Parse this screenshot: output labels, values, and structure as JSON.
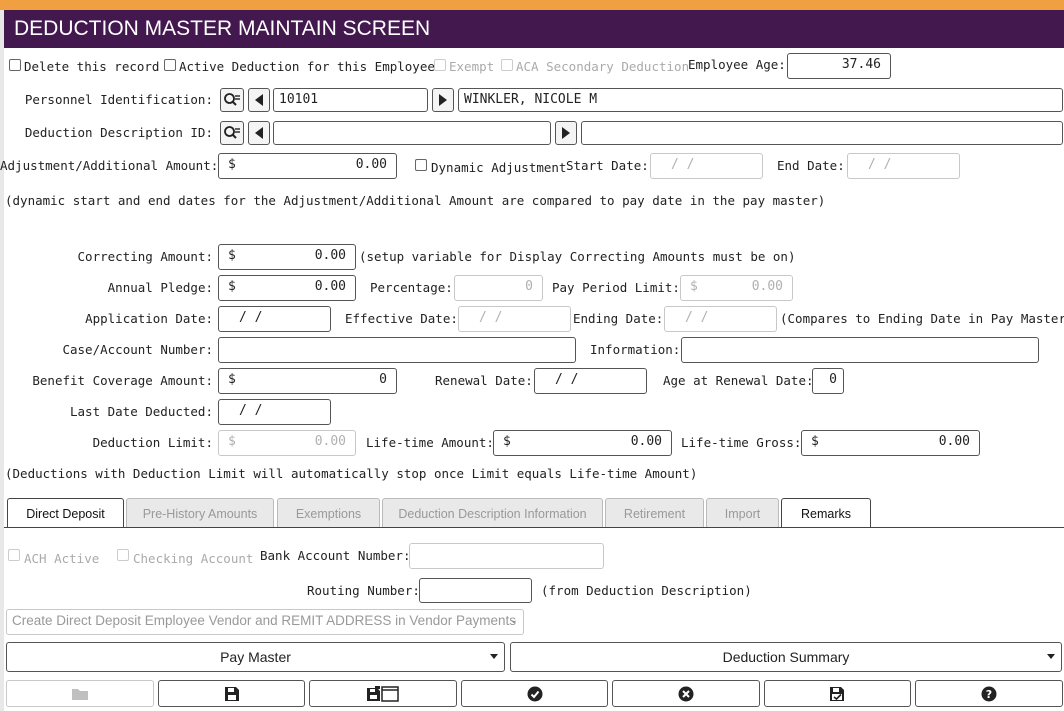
{
  "title": "DEDUCTION MASTER MAINTAIN SCREEN",
  "flags": {
    "delete_label": "Delete this record",
    "active_label": "Active Deduction for this Employee",
    "exempt_label": "Exempt",
    "aca_label": "ACA Secondary Deduction",
    "age_label": "Employee Age:",
    "age_value": "37.46"
  },
  "personnel": {
    "label": "Personnel Identification:",
    "id": "10101",
    "name": "WINKLER, NICOLE M"
  },
  "deduction": {
    "label": "Deduction Description ID:",
    "id": "",
    "desc": ""
  },
  "adjustment": {
    "label": "Adjustment/Additional Amount:",
    "currency": "$",
    "value": "0.00",
    "dynamic_label": "Dynamic Adjustment",
    "start_label": "Start Date:",
    "start_value": "/  /",
    "end_label": "End Date:",
    "end_value": "/  /",
    "note": "(dynamic start and end dates for the Adjustment/Additional Amount are compared to pay date in the pay master)"
  },
  "correcting": {
    "label": "Correcting Amount:",
    "currency": "$",
    "value": "0.00",
    "note": "(setup variable for Display Correcting Amounts must be on)"
  },
  "pledge": {
    "label": "Annual Pledge:",
    "currency": "$",
    "value": "0.00",
    "pct_label": "Percentage:",
    "pct_value": "0",
    "limit_label": "Pay Period Limit:",
    "limit_currency": "$",
    "limit_value": "0.00"
  },
  "dates": {
    "app_label": "Application Date:",
    "app_value": "/  /",
    "eff_label": "Effective Date:",
    "eff_value": "/  /",
    "end_label": "Ending Date:",
    "end_value": "/  /",
    "end_note": "(Compares to Ending Date in Pay Master)"
  },
  "case": {
    "label": "Case/Account Number:",
    "value": "",
    "info_label": "Information:",
    "info_value": ""
  },
  "benefit": {
    "label": "Benefit Coverage Amount:",
    "currency": "$",
    "value": "0",
    "renewal_label": "Renewal Date:",
    "renewal_value": "/  /",
    "age_label": "Age at Renewal Date:",
    "age_value": "0"
  },
  "last": {
    "label": "Last Date Deducted:",
    "value": "/  /"
  },
  "limits": {
    "label": "Deduction Limit:",
    "currency": "$",
    "value": "0.00",
    "lifetime_label": "Life-time Amount:",
    "lifetime_currency": "$",
    "lifetime_value": "0.00",
    "gross_label": "Life-time Gross:",
    "gross_currency": "$",
    "gross_value": "0.00",
    "note": "(Deductions with Deduction Limit will automatically stop once Limit equals Life-time Amount)"
  },
  "tabs": [
    {
      "label": "Direct Deposit",
      "active": true
    },
    {
      "label": "Pre-History Amounts",
      "active": false
    },
    {
      "label": "Exemptions",
      "active": false
    },
    {
      "label": "Deduction Description Information",
      "active": false
    },
    {
      "label": "Retirement",
      "active": false
    },
    {
      "label": "Import",
      "active": false
    },
    {
      "label": "Remarks",
      "active": true
    }
  ],
  "direct_deposit": {
    "ach_label": "ACH Active",
    "checking_label": "Checking Account",
    "bank_label": "Bank Account Number:",
    "bank_value": "",
    "routing_label": "Routing Number:",
    "routing_value": "",
    "routing_note": "(from Deduction Description)",
    "vendor_select": "Create Direct Deposit Employee Vendor and REMIT ADDRESS in Vendor Payments"
  },
  "nav": {
    "pay_master": "Pay Master",
    "deduction_summary": "Deduction Summary"
  },
  "toolbar": [
    "folder-icon",
    "save-icon",
    "save-new-icon",
    "confirm-icon",
    "cancel-icon",
    "save-close-icon",
    "help-icon"
  ]
}
